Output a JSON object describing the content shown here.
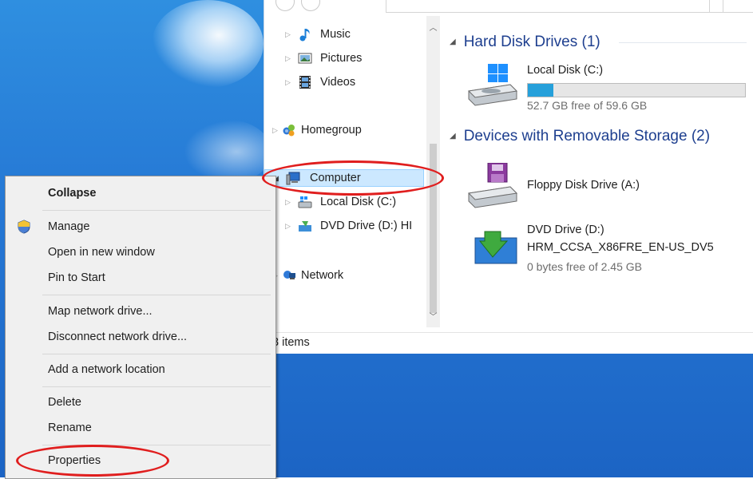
{
  "explorer": {
    "nav_tree": {
      "music": "Music",
      "pictures": "Pictures",
      "videos": "Videos",
      "homegroup": "Homegroup",
      "computer": "Computer",
      "local_disk": "Local Disk (C:)",
      "dvd_drive": "DVD Drive (D:) HI",
      "network": "Network"
    },
    "status": "3 items",
    "groups": {
      "hard_disks": "Hard Disk Drives (1)",
      "removable": "Devices with Removable Storage (2)"
    },
    "drives": {
      "c": {
        "name": "Local Disk (C:)",
        "free": "52.7 GB free of 59.6 GB",
        "used_fraction": 0.116
      },
      "a": {
        "name": "Floppy Disk Drive (A:)"
      },
      "d": {
        "name": "DVD Drive (D:)",
        "label": "HRM_CCSA_X86FRE_EN-US_DV5",
        "free": "0 bytes free of 2.45 GB"
      }
    },
    "colors": {
      "group_header": "#1e3f8f",
      "capacity_fill": "#26a0da"
    }
  },
  "context_menu": {
    "collapse": "Collapse",
    "manage": "Manage",
    "open_new_window": "Open in new window",
    "pin_to_start": "Pin to Start",
    "map_drive": "Map network drive...",
    "disconnect_drive": "Disconnect network drive...",
    "add_location": "Add a network location",
    "delete": "Delete",
    "rename": "Rename",
    "properties": "Properties"
  },
  "annotations": {
    "color": "#e01e1e"
  }
}
